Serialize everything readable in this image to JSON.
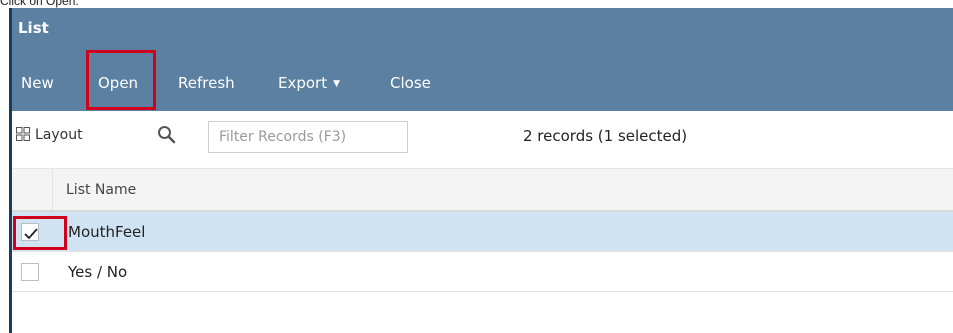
{
  "caption": "Click on Open.",
  "window": {
    "title": "List"
  },
  "toolbar": {
    "new_label": "New",
    "open_label": "Open",
    "refresh_label": "Refresh",
    "export_label": "Export",
    "close_label": "Close"
  },
  "filterbar": {
    "layout_label": "Layout",
    "filter_placeholder": "Filter Records (F3)",
    "record_count": "2 records (1 selected)"
  },
  "grid": {
    "columns": [
      "List Name"
    ],
    "rows": [
      {
        "name": "MouthFeel",
        "selected": true
      },
      {
        "name": "Yes / No",
        "selected": false
      }
    ]
  },
  "colors": {
    "header_bg": "#5b80a1",
    "selected_row": "#cfe3f2",
    "highlight": "#d0021b"
  }
}
